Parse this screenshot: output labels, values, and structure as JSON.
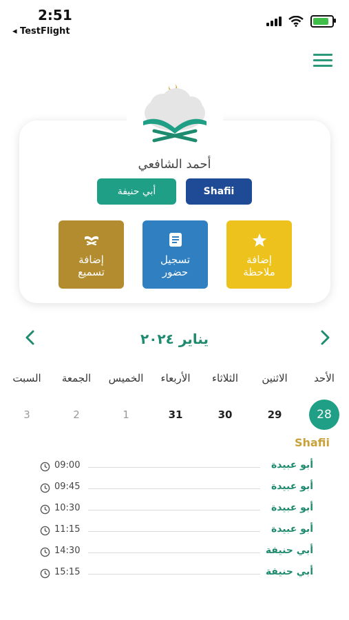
{
  "status_bar": {
    "time": "2:51",
    "back_app": "◂ TestFlight"
  },
  "colors": {
    "accent": "#1f9f86",
    "accent_dark": "#1e8a6e",
    "shafii_blue": "#1e4a96",
    "gold": "#c9a13a"
  },
  "profile": {
    "name": "أحمد الشافعي"
  },
  "madhab_buttons": {
    "hanafi": "أبي حنيفة",
    "shafii": "Shafii"
  },
  "actions": {
    "listen": {
      "label": "إضافة\nتسميع",
      "icon": "open-book-icon"
    },
    "attend": {
      "label": "تسجيل\nحضور",
      "icon": "document-icon"
    },
    "note": {
      "label": "إضافة\nملاحظة",
      "icon": "star-icon"
    }
  },
  "calendar": {
    "month": "يناير ٢٠٢٤",
    "weekdays": [
      "الأحد",
      "الاثنين",
      "الثلاثاء",
      "الأربعاء",
      "الخميس",
      "الجمعة",
      "السبت"
    ],
    "days": [
      {
        "label": "28",
        "state": "selected"
      },
      {
        "label": "29",
        "state": "current"
      },
      {
        "label": "30",
        "state": "current"
      },
      {
        "label": "31",
        "state": "current"
      },
      {
        "label": "1",
        "state": "dim"
      },
      {
        "label": "2",
        "state": "dim"
      },
      {
        "label": "3",
        "state": "dim"
      }
    ]
  },
  "sessions": {
    "heading": "Shafii",
    "items": [
      {
        "time": "09:00",
        "teacher": "أبو عبيدة"
      },
      {
        "time": "09:45",
        "teacher": "أبو عبيدة"
      },
      {
        "time": "10:30",
        "teacher": "أبو عبيدة"
      },
      {
        "time": "11:15",
        "teacher": "أبو عبيدة"
      },
      {
        "time": "14:30",
        "teacher": "أبي حنيفة"
      },
      {
        "time": "15:15",
        "teacher": "أبي حنيفة"
      }
    ]
  }
}
